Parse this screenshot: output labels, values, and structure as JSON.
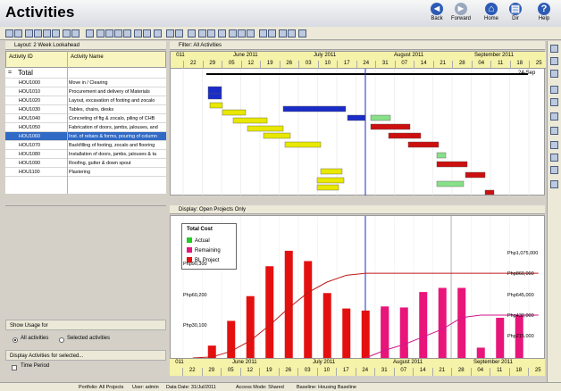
{
  "app": {
    "title": "Activities",
    "nav": [
      {
        "label": "Back",
        "icon": "back-arrow-icon",
        "color": "#2d5bb5"
      },
      {
        "label": "Forward",
        "icon": "forward-arrow-icon",
        "color": "#9aa8c0"
      },
      {
        "label": "Home",
        "icon": "home-icon",
        "color": "#2d5bb5"
      },
      {
        "label": "Dir",
        "icon": "directory-icon",
        "color": "#2d5bb5"
      },
      {
        "label": "Help",
        "icon": "help-icon",
        "color": "#2d5bb5"
      }
    ]
  },
  "layout_panel": {
    "label": "Layout: 2 Week Lookahead",
    "columns": {
      "id": "Activity ID",
      "name": "Activity Name"
    },
    "group": {
      "expander": "=",
      "label": "Total"
    },
    "rows": [
      {
        "id": "HOU1000",
        "name": "Move in / Clearing",
        "selected": false
      },
      {
        "id": "HOU1010",
        "name": "Procurement and delivery of Materials",
        "selected": false
      },
      {
        "id": "HOU1020",
        "name": "Layout, excavation of footing and zocalo",
        "selected": false
      },
      {
        "id": "HOU1030",
        "name": "Tables, chairs, desks",
        "selected": false
      },
      {
        "id": "HOU1040",
        "name": "Concreting of ftg & zocalo, piling of CHB",
        "selected": false
      },
      {
        "id": "HOU1050",
        "name": "Fabrication of doors, jambs, jalouses, and",
        "selected": false
      },
      {
        "id": "HOU1060",
        "name": "Inst. of rebars & forms, pouring of column",
        "selected": true
      },
      {
        "id": "HOU1070",
        "name": "Backfilling of footing, zocalo and flooring",
        "selected": false
      },
      {
        "id": "HOU1080",
        "name": "Installation of doors, jambs, jalouses & ta",
        "selected": false
      },
      {
        "id": "HOU1090",
        "name": "Roofing, gutter & down spout",
        "selected": false
      },
      {
        "id": "HOU1100",
        "name": "Plastering",
        "selected": false
      }
    ]
  },
  "filter_panel": {
    "label": "Filter: All Activities",
    "end_marker": "24-Sep"
  },
  "timescale": {
    "months": [
      "June 2011",
      "July 2011",
      "August 2011",
      "September 2011"
    ],
    "days": [
      "22",
      "29",
      "05",
      "12",
      "19",
      "26",
      "03",
      "10",
      "17",
      "24",
      "31",
      "07",
      "14",
      "21",
      "28",
      "04",
      "11",
      "18",
      "25"
    ],
    "partial_left": "011"
  },
  "display_panel": {
    "label": "Display: Open Projects Only"
  },
  "usage_options": {
    "title": "Show Usage for",
    "all": "All activities",
    "selected": "Selected activities",
    "display_for": "Display Activities for selected...",
    "time_period": "Time Period"
  },
  "chart_data": {
    "type": "bar",
    "title": "Total Cost",
    "legend": {
      "placement": "top-left",
      "entries": [
        {
          "name": "Actual",
          "color": "#22cc22"
        },
        {
          "name": "Remaining",
          "color": "#e8157a"
        },
        {
          "name": "BL Project",
          "color": "#e41010"
        }
      ]
    },
    "left_axis": {
      "ticks": [
        {
          "label": "Php90,300",
          "value": 90300
        },
        {
          "label": "Php60,200",
          "value": 60200
        },
        {
          "label": "Php30,100",
          "value": 30100
        }
      ],
      "ylim": [
        0,
        120400
      ]
    },
    "right_axis": {
      "ticks": [
        {
          "label": "Php1,075,000",
          "value": 1075000
        },
        {
          "label": "Php860,000",
          "value": 860000
        },
        {
          "label": "Php645,000",
          "value": 645000
        },
        {
          "label": "Php430,000",
          "value": 430000
        },
        {
          "label": "Php215,000",
          "value": 215000
        }
      ]
    },
    "categories": [
      "22",
      "29",
      "05",
      "12",
      "19",
      "26",
      "03",
      "10",
      "17",
      "24",
      "31",
      "07",
      "14",
      "21",
      "28",
      "04",
      "11",
      "18",
      "25"
    ],
    "series": [
      {
        "name": "BL Project",
        "color": "#e41010",
        "values": [
          null,
          12000,
          36000,
          60000,
          89000,
          104000,
          94000,
          63000,
          48000,
          46000,
          47000,
          10000,
          null,
          null,
          null,
          null,
          null,
          null,
          null
        ]
      },
      {
        "name": "Remaining",
        "color": "#e8157a",
        "values": [
          null,
          null,
          null,
          null,
          null,
          null,
          null,
          null,
          null,
          null,
          50000,
          49000,
          64000,
          68000,
          68000,
          10000,
          39000,
          41000,
          null
        ]
      }
    ],
    "cumulative_lines": [
      {
        "name": "BL Project",
        "color": "#c01818",
        "values": [
          0,
          10000,
          70000,
          180000,
          340000,
          520000,
          680000,
          790000,
          860000,
          880000,
          880000,
          880000,
          880000,
          880000,
          880000,
          880000,
          880000,
          880000,
          880000
        ]
      },
      {
        "name": "Remaining",
        "color": "#d0178a",
        "values": [
          null,
          null,
          null,
          null,
          null,
          null,
          null,
          null,
          null,
          0,
          80000,
          140000,
          220000,
          300000,
          420000,
          445000,
          445000,
          445000,
          445000
        ]
      }
    ]
  },
  "status_bar": {
    "portfolio": "Portfolio: All Projects",
    "user": "User: admin",
    "data_date": "Data Date: 31/Jul/2011",
    "access": "Access Mode: Shared",
    "baseline": "Baseline: Housing Baseline"
  },
  "colors": {
    "gantt_yellow": "#e8e800",
    "gantt_blue": "#1a2cc8",
    "gantt_red": "#cc1010",
    "gantt_green": "#88e088",
    "selection": "#316ac5"
  }
}
